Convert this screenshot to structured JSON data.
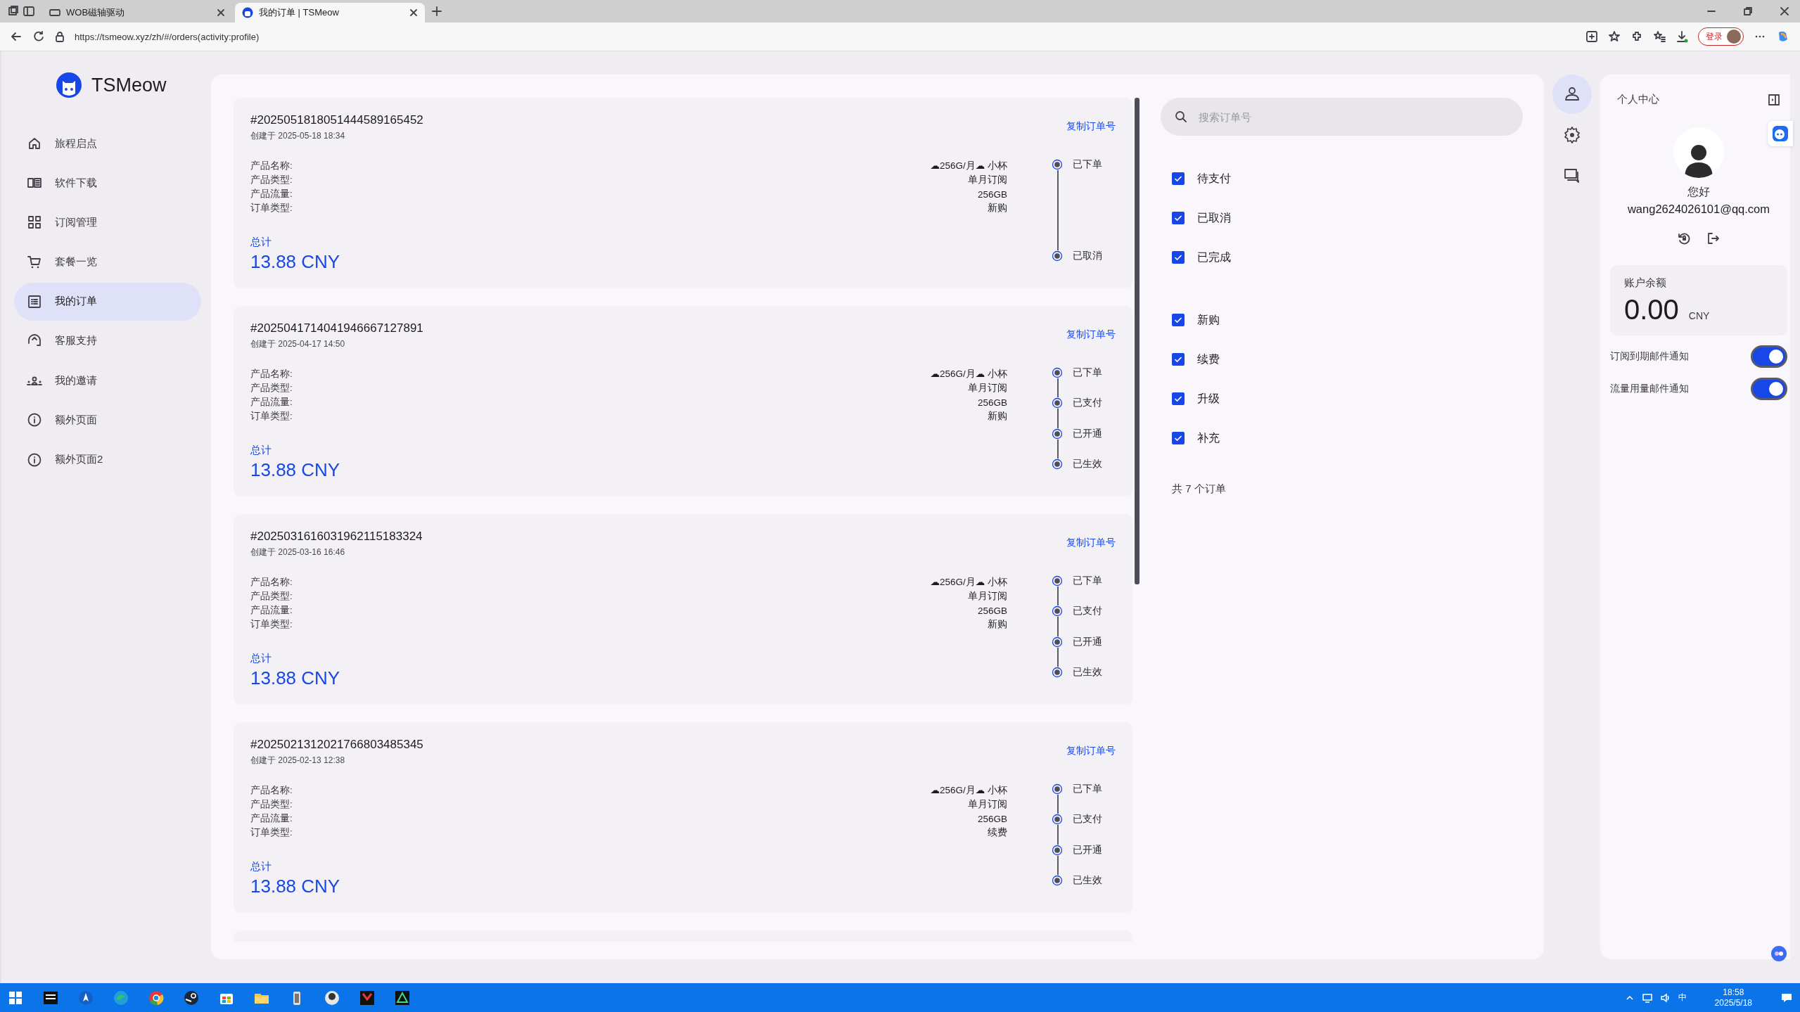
{
  "browser": {
    "tabs": [
      {
        "title": "WOB磁轴驱动",
        "selected": false
      },
      {
        "title": "我的订单 | TSMeow",
        "selected": true
      }
    ],
    "url": "https://tsmeow.xyz/zh/#/orders(activity:profile)",
    "login_button": "登录"
  },
  "sidebar": {
    "brand": "TSMeow",
    "items": [
      {
        "label": "旅程启点",
        "selected": false
      },
      {
        "label": "软件下载",
        "selected": false
      },
      {
        "label": "订阅管理",
        "selected": false
      },
      {
        "label": "套餐一览",
        "selected": false
      },
      {
        "label": "我的订单",
        "selected": true
      },
      {
        "label": "客服支持",
        "selected": false
      },
      {
        "label": "我的邀请",
        "selected": false
      },
      {
        "label": "额外页面",
        "selected": false
      },
      {
        "label": "额外页面2",
        "selected": false
      }
    ]
  },
  "orders": [
    {
      "kind": "full",
      "number": "#2025051818051444589165452",
      "created": "创建于 2025-05-18 18:34",
      "copy_label": "复制订单号",
      "fields": [
        {
          "label": "产品名称:",
          "value": "☁256G/月☁ 小杯"
        },
        {
          "label": "产品类型:",
          "value": "单月订阅"
        },
        {
          "label": "产品流量:",
          "value": "256GB"
        },
        {
          "label": "订单类型:",
          "value": "新购"
        }
      ],
      "total_label": "总计",
      "total": "13.88 CNY",
      "steps": [
        "已下单",
        "已取消"
      ]
    },
    {
      "kind": "full",
      "number": "#2025041714041946667127891",
      "created": "创建于 2025-04-17 14:50",
      "copy_label": "复制订单号",
      "fields": [
        {
          "label": "产品名称:",
          "value": "☁256G/月☁ 小杯"
        },
        {
          "label": "产品类型:",
          "value": "单月订阅"
        },
        {
          "label": "产品流量:",
          "value": "256GB"
        },
        {
          "label": "订单类型:",
          "value": "新购"
        }
      ],
      "total_label": "总计",
      "total": "13.88 CNY",
      "steps": [
        "已下单",
        "已支付",
        "已开通",
        "已生效"
      ]
    },
    {
      "kind": "full",
      "number": "#2025031616031962115183324",
      "created": "创建于 2025-03-16 16:46",
      "copy_label": "复制订单号",
      "fields": [
        {
          "label": "产品名称:",
          "value": "☁256G/月☁ 小杯"
        },
        {
          "label": "产品类型:",
          "value": "单月订阅"
        },
        {
          "label": "产品流量:",
          "value": "256GB"
        },
        {
          "label": "订单类型:",
          "value": "新购"
        }
      ],
      "total_label": "总计",
      "total": "13.88 CNY",
      "steps": [
        "已下单",
        "已支付",
        "已开通",
        "已生效"
      ]
    },
    {
      "kind": "full",
      "number": "#2025021312021766803485345",
      "created": "创建于 2025-02-13 12:38",
      "copy_label": "复制订单号",
      "fields": [
        {
          "label": "产品名称:",
          "value": "☁256G/月☁ 小杯"
        },
        {
          "label": "产品类型:",
          "value": "单月订阅"
        },
        {
          "label": "产品流量:",
          "value": "256GB"
        },
        {
          "label": "订单类型:",
          "value": "续费"
        }
      ],
      "total_label": "总计",
      "total": "13.88 CNY",
      "steps": [
        "已下单",
        "已支付",
        "已开通",
        "已生效"
      ]
    },
    {
      "kind": "clipped"
    }
  ],
  "filters": {
    "search_placeholder": "搜索订单号",
    "status": [
      {
        "label": "待支付",
        "checked": true
      },
      {
        "label": "已取消",
        "checked": true
      },
      {
        "label": "已完成",
        "checked": true
      }
    ],
    "types": [
      {
        "label": "新购",
        "checked": true
      },
      {
        "label": "续费",
        "checked": true
      },
      {
        "label": "升级",
        "checked": true
      },
      {
        "label": "补充",
        "checked": true
      }
    ],
    "count": "共 7 个订单"
  },
  "rail": [
    {
      "selected": true
    },
    {
      "selected": false
    },
    {
      "selected": false
    }
  ],
  "profile": {
    "title": "个人中心",
    "greeting": "您好",
    "email": "wang2624026101@qq.com",
    "balance_label": "账户余额",
    "balance": "0.00",
    "currency": "CNY",
    "toggles": [
      {
        "label": "订阅到期邮件通知",
        "on": true
      },
      {
        "label": "流量用量邮件通知",
        "on": true
      }
    ]
  },
  "taskbar": {
    "ime": "中",
    "time": "18:58",
    "date": "2025/5/18"
  }
}
